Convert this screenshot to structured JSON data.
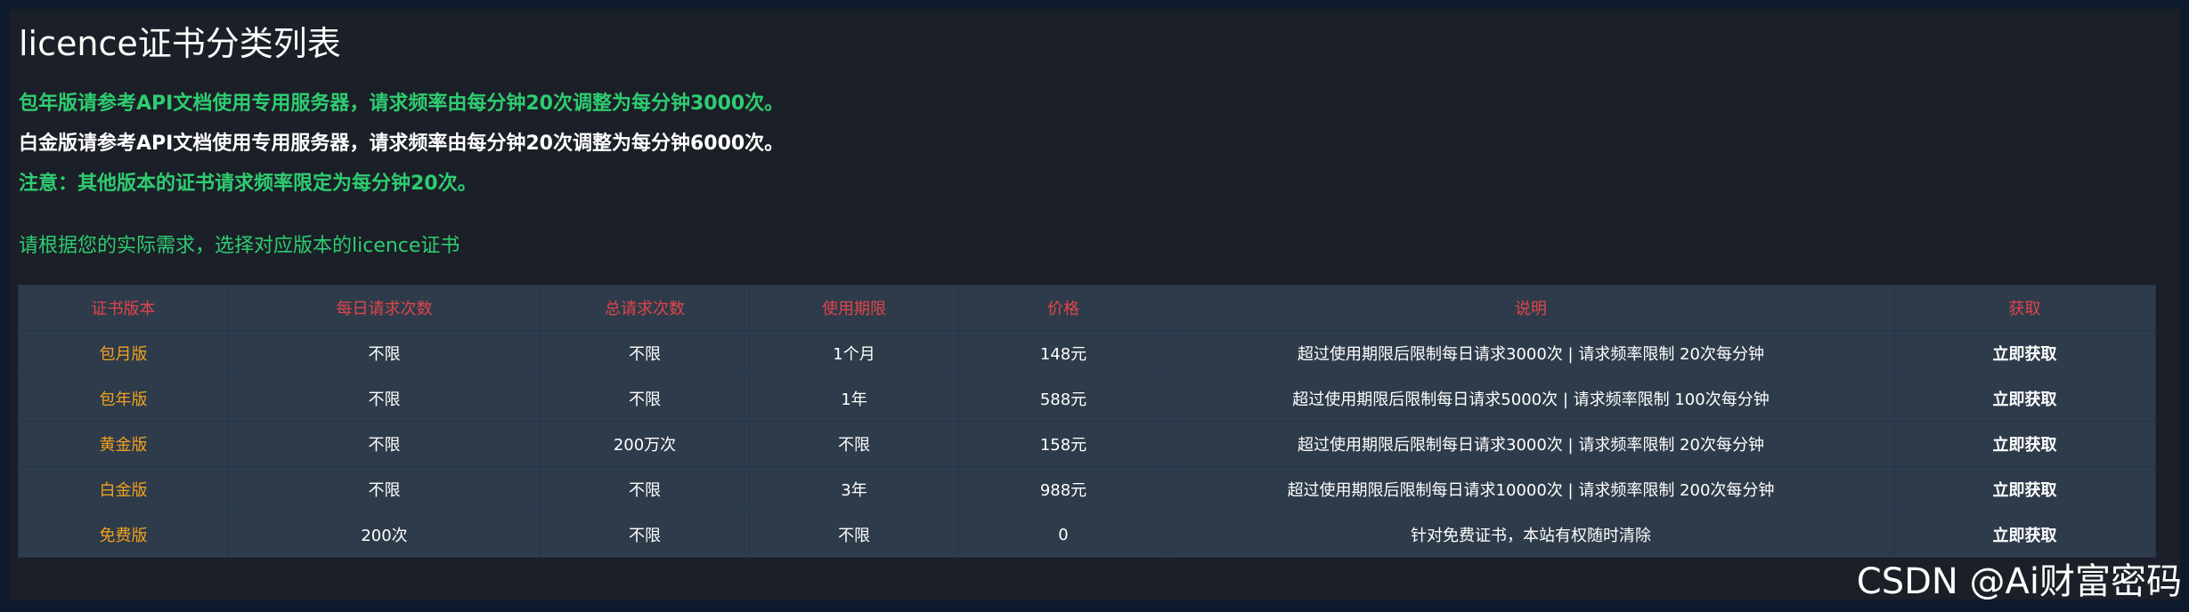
{
  "page": {
    "title": "licence证书分类列表",
    "notices": [
      "包年版请参考API文档使用专用服务器，请求频率由每分钟20次调整为每分钟3000次。",
      "白金版请参考API文档使用专用服务器，请求频率由每分钟20次调整为每分钟6000次。",
      "注意：其他版本的证书请求频率限定为每分钟20次。"
    ],
    "prompt": "请根据您的实际需求，选择对应版本的licence证书"
  },
  "table": {
    "headers": [
      "证书版本",
      "每日请求次数",
      "总请求次数",
      "使用期限",
      "价格",
      "说明",
      "获取"
    ],
    "rows": [
      {
        "version": "包月版",
        "daily": "不限",
        "total": "不限",
        "period": "1个月",
        "price": "148元",
        "desc": "超过使用期限后限制每日请求3000次 | 请求频率限制 20次每分钟",
        "action": "立即获取"
      },
      {
        "version": "包年版",
        "daily": "不限",
        "total": "不限",
        "period": "1年",
        "price": "588元",
        "desc": "超过使用期限后限制每日请求5000次 | 请求频率限制 100次每分钟",
        "action": "立即获取"
      },
      {
        "version": "黄金版",
        "daily": "不限",
        "total": "200万次",
        "period": "不限",
        "price": "158元",
        "desc": "超过使用期限后限制每日请求3000次 | 请求频率限制 20次每分钟",
        "action": "立即获取"
      },
      {
        "version": "白金版",
        "daily": "不限",
        "total": "不限",
        "period": "3年",
        "price": "988元",
        "desc": "超过使用期限后限制每日请求10000次 | 请求频率限制 200次每分钟",
        "action": "立即获取"
      },
      {
        "version": "免费版",
        "daily": "200次",
        "total": "不限",
        "period": "不限",
        "price": "0",
        "desc": "针对免费证书，本站有权随时清除",
        "action": "立即获取"
      }
    ]
  },
  "watermark": "CSDN @Ai财富密码",
  "colors": {
    "background": "#0d1a2e",
    "panel": "#1b1f27",
    "green_text": "#2ecc71",
    "header_text": "#e0454a",
    "version_text": "#f0a020",
    "table_bg": "#2e3b4a",
    "table_border": "#22344d"
  }
}
